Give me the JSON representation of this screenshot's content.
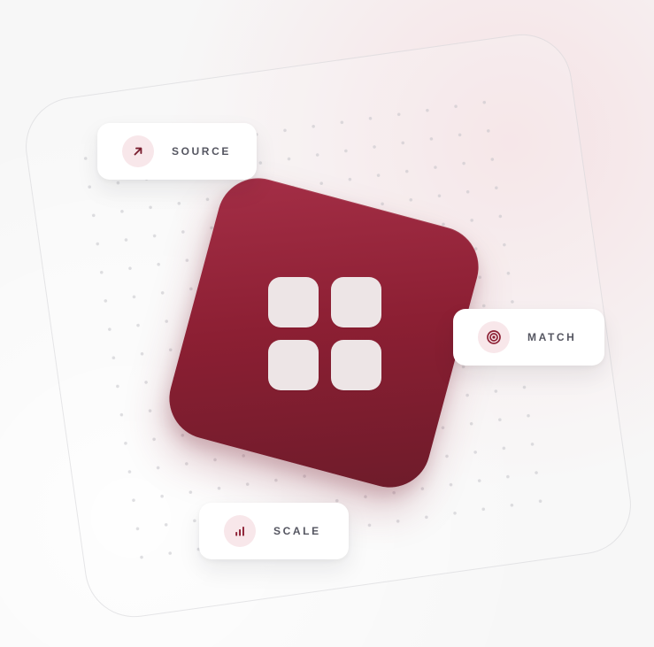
{
  "colors": {
    "accent": "#8c1f33",
    "tile_light": "#a52f47",
    "tile_dark": "#6d1b2a",
    "icon_bg": "#f8e7ea",
    "label": "#555661",
    "app_icon_squares": "#ede5e6"
  },
  "app_tile": {
    "icon": "four-squares-grid-icon"
  },
  "pills": [
    {
      "label": "SOURCE",
      "icon": "arrow-up-right-icon"
    },
    {
      "label": "MATCH",
      "icon": "target-icon"
    },
    {
      "label": "SCALE",
      "icon": "bar-chart-icon"
    }
  ]
}
